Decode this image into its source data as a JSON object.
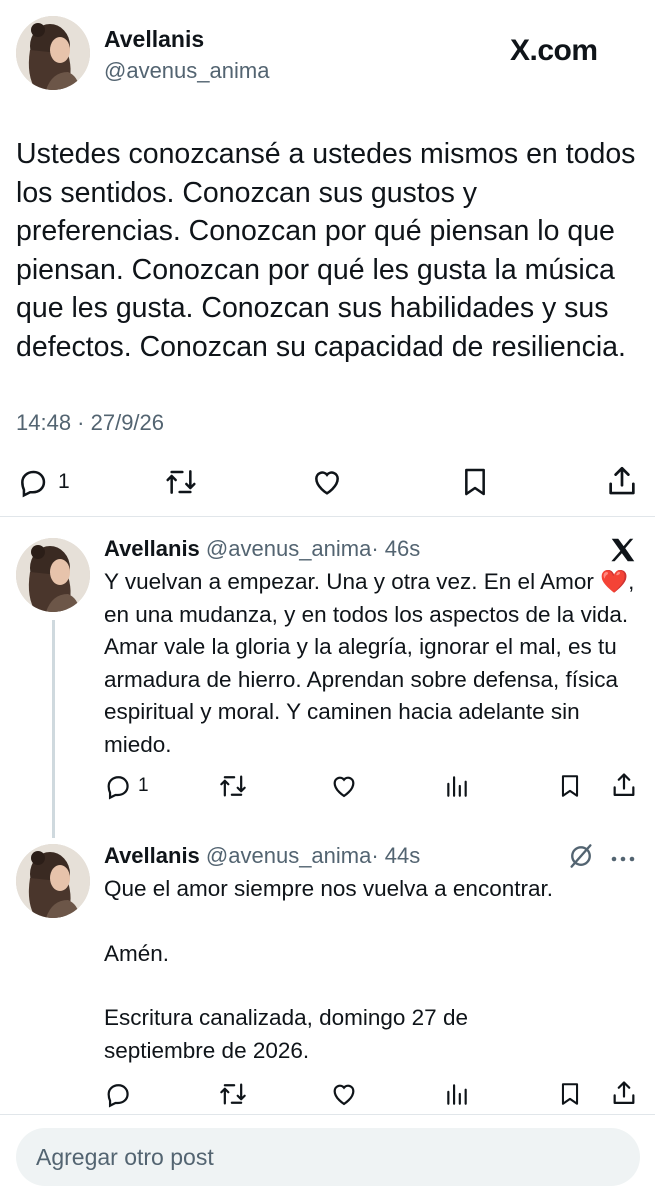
{
  "main_post": {
    "display_name": "Avellanis",
    "handle": "@avenus_anima",
    "brand": "X.com",
    "text": "Ustedes conozcansé a ustedes mismos en todos los sentidos. Conozcan sus gustos y preferencias. Conozcan por qué piensan lo que piensan. Conozcan por qué les gusta la música que les gusta. Conozcan sus habilidades y sus defectos. Conozcan su capacidad de resiliencia.",
    "timestamp": "14:48 · 27/9/26",
    "reply_count": "1"
  },
  "replies": [
    {
      "display_name": "Avellanis",
      "handle": "@avenus_anima",
      "age": "· 46s",
      "text_part1": "Y vuelvan a empezar. Una y otra vez. En el Amor",
      "heart_emoji": "❤️",
      "text_part2": ", en una mudanza, y en todos los aspectos de la vida. Amar vale la gloria y la alegría, ignorar el mal, es tu armadura de hierro. Aprendan sobre defensa, física espiritual y moral. Y caminen hacia adelante sin miedo.",
      "reply_count": "1"
    },
    {
      "display_name": "Avellanis",
      "handle": "@avenus_anima",
      "age": "· 44s",
      "line1": "Que el amor siempre nos vuelva a encontrar.",
      "line2": "Amén.",
      "line3": "Escritura canalizada, domingo 27 de septiembre de 2026."
    }
  ],
  "composer": {
    "placeholder": "Agregar otro post"
  },
  "colors": {
    "text": "#0f1419",
    "secondary": "#536471",
    "divider": "#e1e6ea",
    "heart": "#f91880"
  }
}
